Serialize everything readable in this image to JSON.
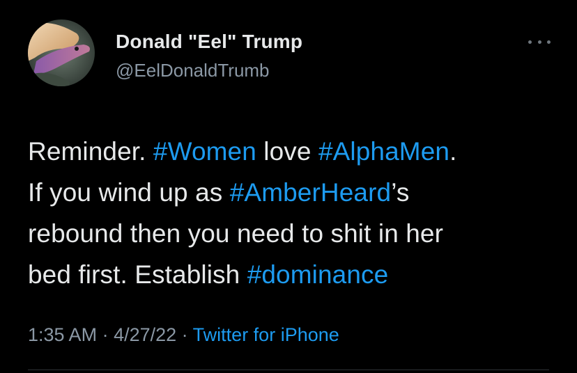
{
  "author": {
    "display_name": "Donald \"Eel\" Trump",
    "handle": "@EelDonaldTrumb",
    "avatar_icon": "eel-avatar-icon"
  },
  "more_icon": "more-options-icon",
  "tweet": {
    "lines": [
      [
        {
          "text": "Reminder. ",
          "type": "text"
        },
        {
          "text": "#Women",
          "type": "hashtag"
        },
        {
          "text": " love ",
          "type": "text"
        },
        {
          "text": "#AlphaMen",
          "type": "hashtag"
        },
        {
          "text": ".",
          "type": "text"
        }
      ],
      [
        {
          "text": "If you wind up as ",
          "type": "text"
        },
        {
          "text": "#AmberHeard",
          "type": "hashtag"
        },
        {
          "text": "’s",
          "type": "text"
        }
      ],
      [
        {
          "text": "rebound then you need to shit in her",
          "type": "text"
        }
      ],
      [
        {
          "text": "bed first. Establish ",
          "type": "text"
        },
        {
          "text": "#dominance",
          "type": "hashtag"
        }
      ]
    ]
  },
  "meta": {
    "time": "1:35 AM",
    "sep1": " · ",
    "date": "4/27/22",
    "sep2": " · ",
    "source": "Twitter for iPhone"
  },
  "colors": {
    "background": "#000000",
    "text": "#e7e9ea",
    "secondary": "#8b98a5",
    "link": "#1d9bf0"
  }
}
